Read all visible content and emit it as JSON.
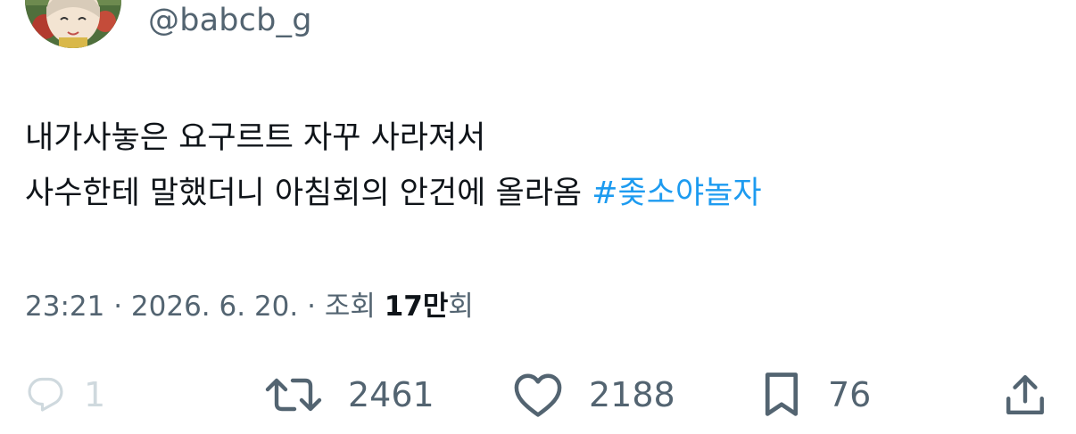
{
  "tweet": {
    "handle": "@babcb_g",
    "text_lines": [
      "내가사놓은 요구르트 자꾸 사라져서",
      "사수한테 말했더니 아침회의 안건에 올라옴 "
    ],
    "hashtag": "#좆소야놀자",
    "hashtag_color": "#1d9bf0"
  },
  "meta": {
    "time": "23:21",
    "separator": " · ",
    "date": "2026. 6. 20.",
    "separator2": " · ",
    "views_prefix": "조회 ",
    "views_number": "17만",
    "views_suffix": "회"
  },
  "actions": {
    "reply": {
      "icon": "reply-icon",
      "count": "1"
    },
    "retweet": {
      "icon": "retweet-icon",
      "count": "2461"
    },
    "like": {
      "icon": "heart-icon",
      "count": "2188"
    },
    "bookmark": {
      "icon": "bookmark-icon",
      "count": "76"
    },
    "share": {
      "icon": "share-icon"
    }
  },
  "colors": {
    "text": "#0f1419",
    "secondary": "#536471",
    "disabled": "#cfd9de"
  }
}
